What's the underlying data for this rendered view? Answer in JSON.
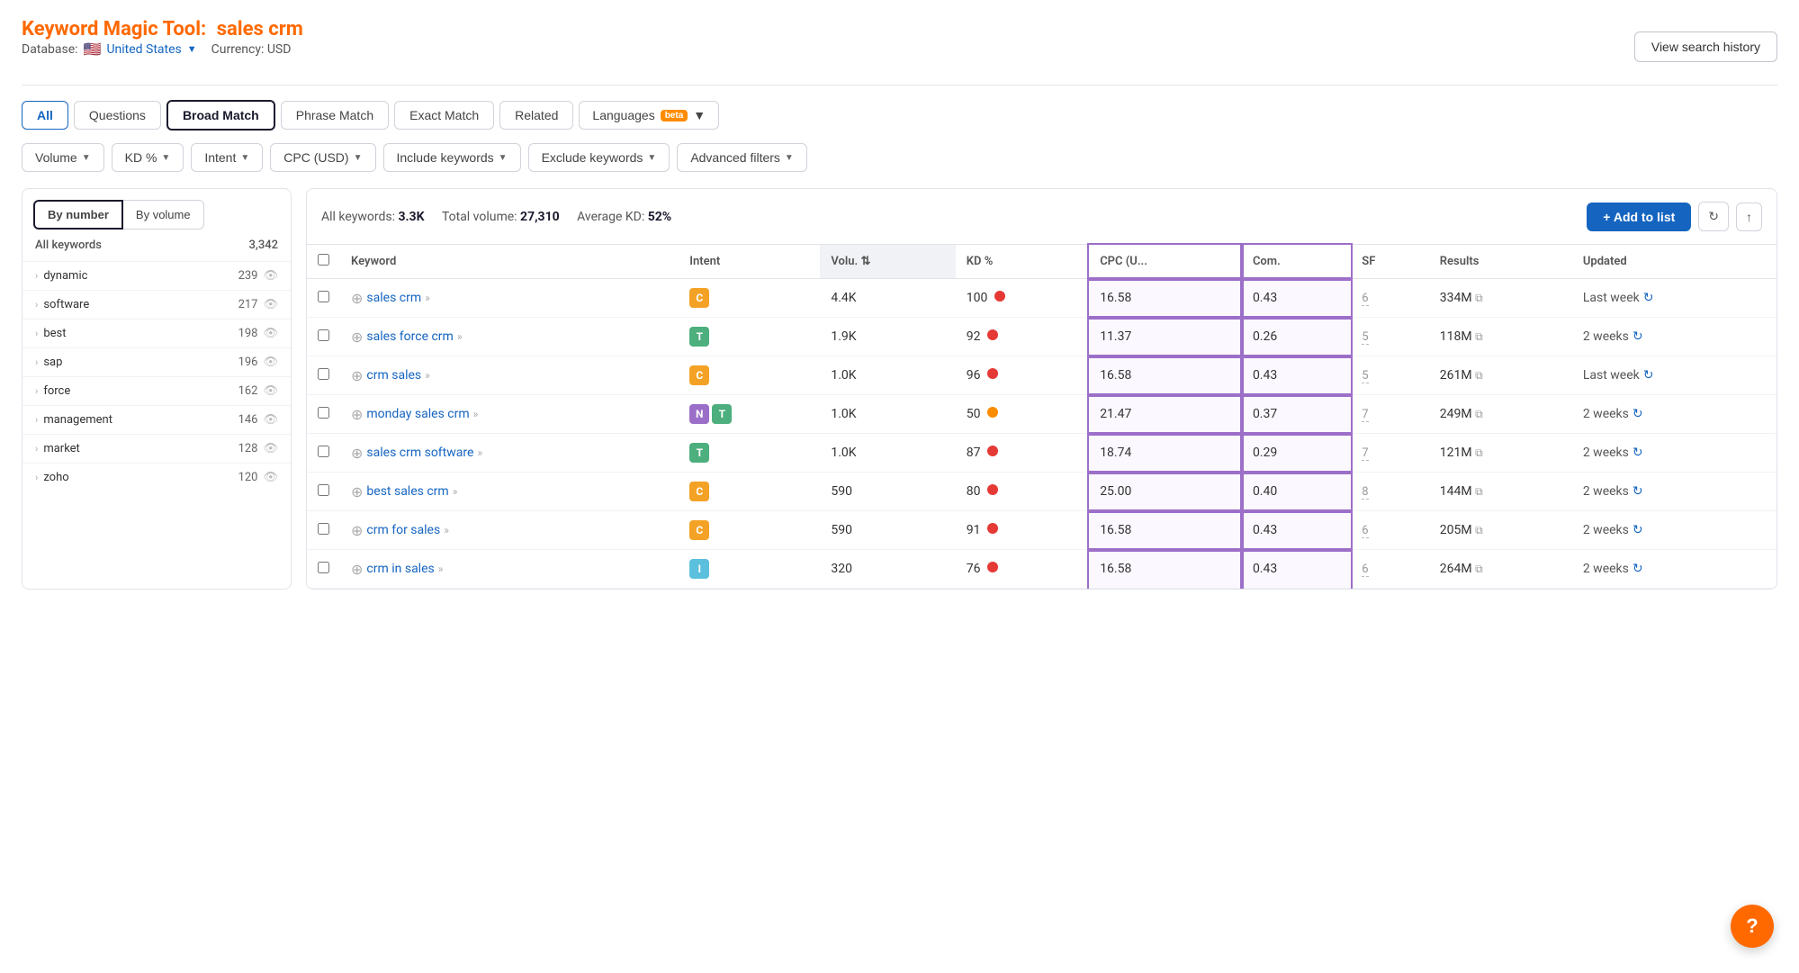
{
  "header": {
    "title_prefix": "Keyword Magic Tool:",
    "title_query": "sales crm",
    "view_history_label": "View search history",
    "database_label": "Database:",
    "database_country": "United States",
    "currency_label": "Currency: USD"
  },
  "tabs": [
    {
      "id": "all",
      "label": "All",
      "active": true
    },
    {
      "id": "questions",
      "label": "Questions",
      "active": false
    },
    {
      "id": "broad-match",
      "label": "Broad Match",
      "active": false,
      "selected": true
    },
    {
      "id": "phrase-match",
      "label": "Phrase Match",
      "active": false
    },
    {
      "id": "exact-match",
      "label": "Exact Match",
      "active": false
    },
    {
      "id": "related",
      "label": "Related",
      "active": false
    }
  ],
  "languages_btn": "Languages",
  "beta_label": "beta",
  "filters": [
    {
      "id": "volume",
      "label": "Volume"
    },
    {
      "id": "kd",
      "label": "KD %"
    },
    {
      "id": "intent",
      "label": "Intent"
    },
    {
      "id": "cpc",
      "label": "CPC (USD)"
    },
    {
      "id": "include",
      "label": "Include keywords"
    },
    {
      "id": "exclude",
      "label": "Exclude keywords"
    },
    {
      "id": "advanced",
      "label": "Advanced filters"
    }
  ],
  "sidebar": {
    "tab_by_number": "By number",
    "tab_by_volume": "By volume",
    "col_all_keywords": "All keywords",
    "col_count": "3,342",
    "items": [
      {
        "label": "dynamic",
        "count": "239"
      },
      {
        "label": "software",
        "count": "217"
      },
      {
        "label": "best",
        "count": "198"
      },
      {
        "label": "sap",
        "count": "196"
      },
      {
        "label": "force",
        "count": "162"
      },
      {
        "label": "management",
        "count": "146"
      },
      {
        "label": "market",
        "count": "128"
      },
      {
        "label": "zoho",
        "count": "120"
      }
    ]
  },
  "results": {
    "all_keywords_label": "All keywords:",
    "all_keywords_value": "3.3K",
    "total_volume_label": "Total volume:",
    "total_volume_value": "27,310",
    "avg_kd_label": "Average KD:",
    "avg_kd_value": "52%",
    "add_to_list_label": "+ Add to list",
    "columns": {
      "keyword": "Keyword",
      "intent": "Intent",
      "volume": "Volu.",
      "kd": "KD %",
      "cpc": "CPC (U...",
      "comp": "Com.",
      "sf": "SF",
      "results": "Results",
      "updated": "Updated"
    },
    "rows": [
      {
        "keyword": "sales crm",
        "intent": [
          "C"
        ],
        "intent_types": [
          "c"
        ],
        "volume": "4.4K",
        "kd": "100",
        "kd_dot": "red",
        "cpc": "16.58",
        "comp": "0.43",
        "sf": "6",
        "results": "334M",
        "updated": "Last week"
      },
      {
        "keyword": "sales force crm",
        "intent": [
          "T"
        ],
        "intent_types": [
          "t"
        ],
        "volume": "1.9K",
        "kd": "92",
        "kd_dot": "red",
        "cpc": "11.37",
        "comp": "0.26",
        "sf": "5",
        "results": "118M",
        "updated": "2 weeks"
      },
      {
        "keyword": "crm sales",
        "intent": [
          "C"
        ],
        "intent_types": [
          "c"
        ],
        "volume": "1.0K",
        "kd": "96",
        "kd_dot": "red",
        "cpc": "16.58",
        "comp": "0.43",
        "sf": "5",
        "results": "261M",
        "updated": "Last week"
      },
      {
        "keyword": "monday sales crm",
        "intent": [
          "N",
          "T"
        ],
        "intent_types": [
          "n",
          "t"
        ],
        "volume": "1.0K",
        "kd": "50",
        "kd_dot": "orange",
        "cpc": "21.47",
        "comp": "0.37",
        "sf": "7",
        "results": "249M",
        "updated": "2 weeks"
      },
      {
        "keyword": "sales crm software",
        "intent": [
          "T"
        ],
        "intent_types": [
          "t"
        ],
        "volume": "1.0K",
        "kd": "87",
        "kd_dot": "red",
        "cpc": "18.74",
        "comp": "0.29",
        "sf": "7",
        "results": "121M",
        "updated": "2 weeks"
      },
      {
        "keyword": "best sales crm",
        "intent": [
          "C"
        ],
        "intent_types": [
          "c"
        ],
        "volume": "590",
        "kd": "80",
        "kd_dot": "red",
        "cpc": "25.00",
        "comp": "0.40",
        "sf": "8",
        "results": "144M",
        "updated": "2 weeks"
      },
      {
        "keyword": "crm for sales",
        "intent": [
          "C"
        ],
        "intent_types": [
          "c"
        ],
        "volume": "590",
        "kd": "91",
        "kd_dot": "red",
        "cpc": "16.58",
        "comp": "0.43",
        "sf": "6",
        "results": "205M",
        "updated": "2 weeks"
      },
      {
        "keyword": "crm in sales",
        "intent": [
          "I"
        ],
        "intent_types": [
          "i"
        ],
        "volume": "320",
        "kd": "76",
        "kd_dot": "red",
        "cpc": "16.58",
        "comp": "0.43",
        "sf": "6",
        "results": "264M",
        "updated": "2 weeks"
      }
    ]
  },
  "help_btn": "?"
}
